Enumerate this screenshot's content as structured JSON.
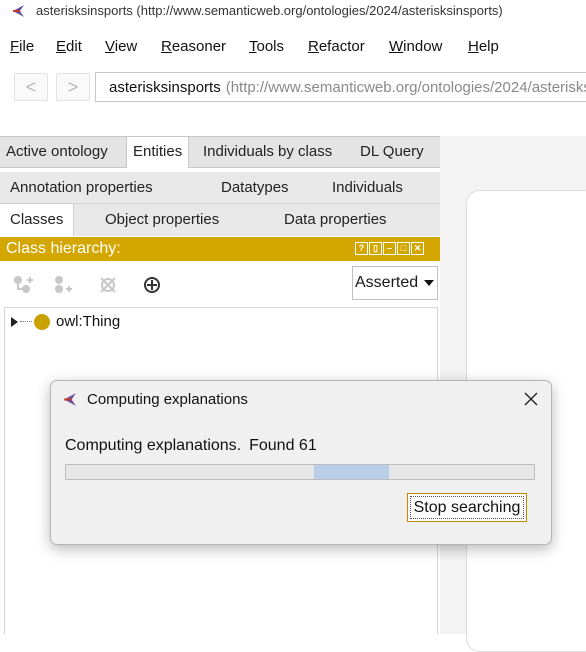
{
  "window": {
    "title": "asterisksinsports (http://www.semanticweb.org/ontologies/2024/asterisksinsports)"
  },
  "menubar": {
    "items": [
      "File",
      "Edit",
      "View",
      "Reasoner",
      "Tools",
      "Refactor",
      "Window",
      "Help"
    ]
  },
  "navbar": {
    "back_label": "<",
    "forward_label": ">",
    "ontology_name": "asterisksinsports",
    "ontology_iri": "(http://www.semanticweb.org/ontologies/2024/asterisksinsports)"
  },
  "tabs": [
    "Active ontology",
    "Entities",
    "Individuals by class",
    "DL Query"
  ],
  "active_tab": "Entities",
  "subtabs_row1": [
    "Annotation properties",
    "Datatypes",
    "Individuals"
  ],
  "subtabs_row2": [
    "Classes",
    "Object properties",
    "Data properties"
  ],
  "class_hierarchy": {
    "header": "Class hierarchy:",
    "view_mode": "Asserted",
    "tree": [
      {
        "label": "owl:Thing"
      }
    ]
  },
  "dialog": {
    "title": "Computing explanations",
    "message": "Computing explanations.",
    "found_label": "Found 61",
    "progress_indeterminate_segment": {
      "start": 0.53,
      "end": 0.69
    },
    "stop_button_label": "Stop searching"
  },
  "colors": {
    "hierarchy_header": "#d4a700",
    "owl_thing_bullet": "#c9a100",
    "progress_fill": "#b9cce8"
  },
  "icons": [
    "protege-app-icon",
    "ontology-diamond-icon",
    "add-subclass-icon",
    "add-sibling-class-icon",
    "delete-class-icon",
    "class-options-icon",
    "close-icon"
  ]
}
